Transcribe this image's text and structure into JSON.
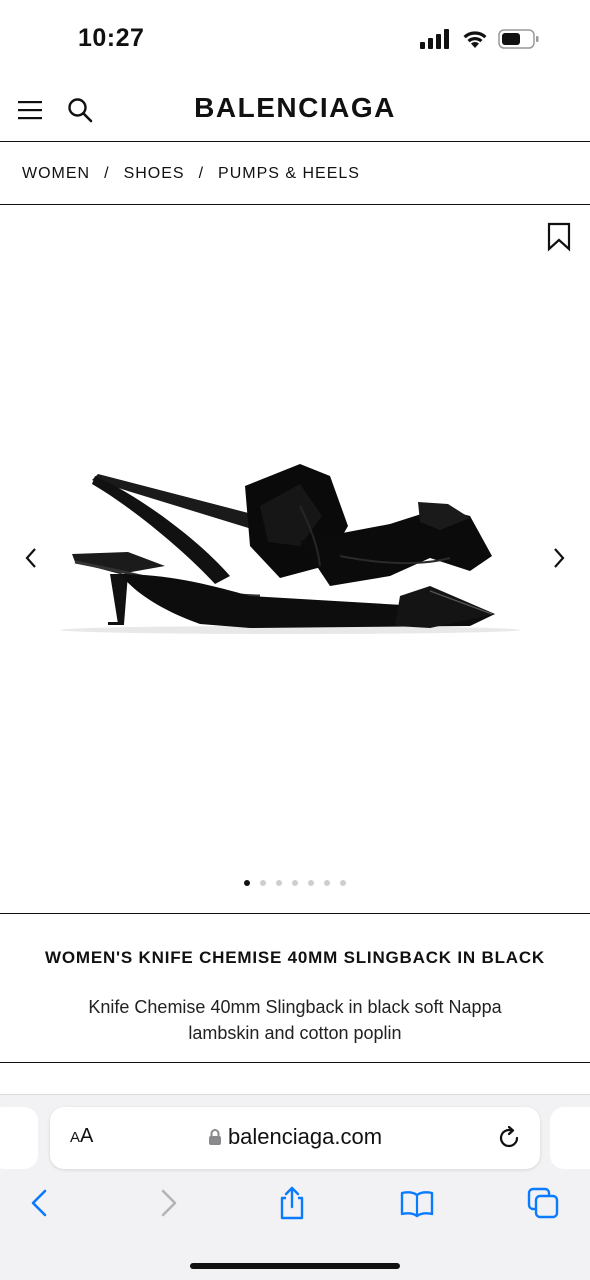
{
  "status_bar": {
    "time": "10:27"
  },
  "header": {
    "brand": "BALENCIAGA"
  },
  "breadcrumb": {
    "items": [
      "WOMEN",
      "SHOES",
      "PUMPS & HEELS"
    ],
    "separator": "/"
  },
  "gallery": {
    "image_count": 7,
    "active_index": 0
  },
  "product": {
    "title": "WOMEN'S KNIFE CHEMISE 40MM SLINGBACK IN BLACK",
    "description": "Knife Chemise 40mm Slingback in black soft Nappa lambskin and cotton poplin"
  },
  "browser": {
    "text_size_label_small": "A",
    "text_size_label_large": "A",
    "url": "balenciaga.com",
    "accent_color": "#0a7aff"
  }
}
